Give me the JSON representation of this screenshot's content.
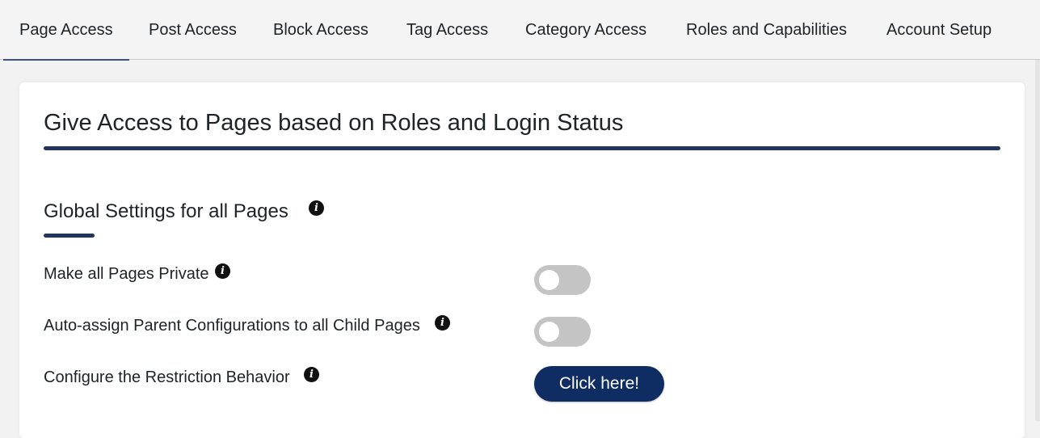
{
  "tabs": [
    {
      "label": "Page Access",
      "active": true
    },
    {
      "label": "Post Access"
    },
    {
      "label": "Block Access"
    },
    {
      "label": "Tag Access"
    },
    {
      "label": "Category Access"
    },
    {
      "label": "Roles and Capabilities"
    },
    {
      "label": "Account Setup"
    }
  ],
  "card": {
    "title": "Give Access to Pages based on Roles and Login Status",
    "section_title": "Global Settings for all Pages",
    "settings": [
      {
        "label": "Make all Pages Private",
        "control": "toggle",
        "enabled": false
      },
      {
        "label": "Auto-assign Parent Configurations to all Child Pages",
        "control": "toggle",
        "enabled": false
      },
      {
        "label": "Configure the Restriction Behavior",
        "control": "button",
        "button_label": "Click here!"
      }
    ]
  },
  "icons": {
    "info": "info-icon",
    "info_glyph": "i"
  },
  "colors": {
    "accent": "#23355f",
    "button": "#0f2d63",
    "toggle_off": "#c4c4c4",
    "background": "#f2f2f2"
  }
}
